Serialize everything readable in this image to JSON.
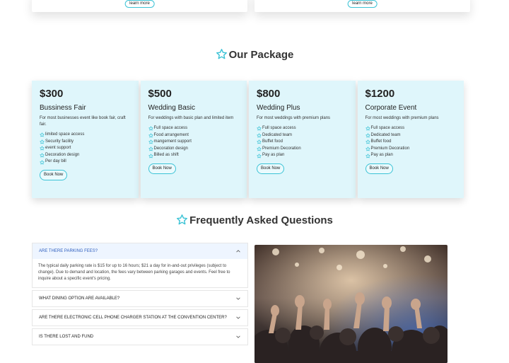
{
  "top_cards": [
    {
      "button": "learn more"
    },
    {
      "button": "learn more"
    }
  ],
  "package_section": {
    "title": "Our Package"
  },
  "packages": [
    {
      "price": "$300",
      "name": "Bussiness Fair",
      "desc": "For most businesses event like book fair, craft fair.",
      "features": [
        "limited space access",
        "Security facility",
        "event support",
        "Decoration design",
        "Per day bill"
      ],
      "button": "Book Now"
    },
    {
      "price": "$500",
      "name": "Wedding Basic",
      "desc": "For weddings with basic plan and limited item",
      "features": [
        "Full space access",
        "Food arrangement",
        "mangement support",
        "Decoration design",
        "Billed as shift"
      ],
      "button": "Book Now"
    },
    {
      "price": "$800",
      "name": "Wedding Plus",
      "desc": "For most weddings with premium plans",
      "features": [
        "Full space access",
        "Dedicated team",
        "Buffet food",
        "Premium Decoration",
        "Pay as plan"
      ],
      "button": "Book Now"
    },
    {
      "price": "$1200",
      "name": "Corporate Event",
      "desc": "For most weddings with premium plans",
      "features": [
        "Full space access",
        "Dedicated team",
        "Buffet food",
        "Premium Decoration",
        "Pay as plan"
      ],
      "button": "Book Now"
    }
  ],
  "faq_section": {
    "title": "Frequently Asked Questions"
  },
  "faq": [
    {
      "question": "ARE THERE PARKING FEES?",
      "answer": "The typical daily parking rate is $15 for up to 16 hours; $21 a day for in-and-out privileges (subject to change). Due to demand and location, the fees vary between parking garages and events. Feel free to inquire about a specific event's pricing.",
      "open": true
    },
    {
      "question": "WHAT DINING OPTION ARE AVAILABLE?",
      "open": false
    },
    {
      "question": "ARE THERE ELECTRONIC CELL PHONE CHARGER STATION AT THE CONVENTION CENTER?",
      "open": false
    },
    {
      "question": "IS THERE LOST AND FUND",
      "open": false
    }
  ],
  "colors": {
    "accent": "#3cc3d6",
    "card_bg": "#dff6fb",
    "faq_active": "#2f5fbf"
  },
  "icons": {
    "section": "star-outline-icon",
    "feature": "star-outline-icon",
    "faq_toggle": "chevron-icon"
  }
}
